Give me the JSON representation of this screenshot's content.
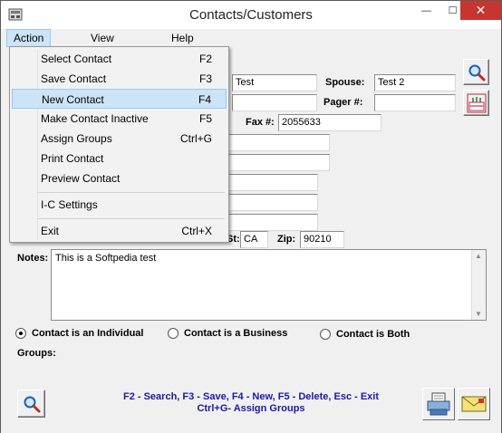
{
  "window": {
    "title": "Contacts/Customers",
    "minimize": "—",
    "maximize": "☐",
    "close": "✕"
  },
  "menubar": {
    "items": [
      "Action",
      "View",
      "Help"
    ]
  },
  "dropdown": {
    "items": [
      {
        "label": "Select Contact",
        "key": "F2"
      },
      {
        "label": "Save Contact",
        "key": "F3"
      },
      {
        "label": "New Contact",
        "key": "F4"
      },
      {
        "label": "Make Contact Inactive",
        "key": "F5"
      },
      {
        "label": "Assign Groups",
        "key": "Ctrl+G"
      },
      {
        "label": "Print Contact",
        "key": ""
      },
      {
        "label": "Preview Contact",
        "key": ""
      },
      {
        "label": "I-C Settings",
        "key": ""
      },
      {
        "label": "Exit",
        "key": "Ctrl+X"
      }
    ],
    "highlighted_index": 2
  },
  "form": {
    "name_value": "Test",
    "spouse_label": "Spouse:",
    "spouse_value": "Test 2",
    "pager_label": "Pager #:",
    "pager_value": "",
    "fax_label": "Fax #:",
    "fax_value": "2055633",
    "state_label": "St:",
    "state_value": "CA",
    "zip_label": "Zip:",
    "zip_value": "90210",
    "notes_label": "Notes:",
    "notes_value": "This is a Softpedia test",
    "radio_individual": "Contact is an Individual",
    "radio_business": "Contact is a Business",
    "radio_both": "Contact is Both",
    "selected_radio": "individual",
    "groups_label": "Groups:"
  },
  "help": {
    "line1": "F2 - Search,  F3 - Save,  F4 - New,  F5 - Delete,  Esc - Exit",
    "line2": "Ctrl+G- Assign Groups"
  },
  "icons": {
    "search": "magnifier-icon",
    "birthday": "birthday-cake-icon",
    "printer": "printer-icon",
    "envelope": "envelope-icon"
  }
}
